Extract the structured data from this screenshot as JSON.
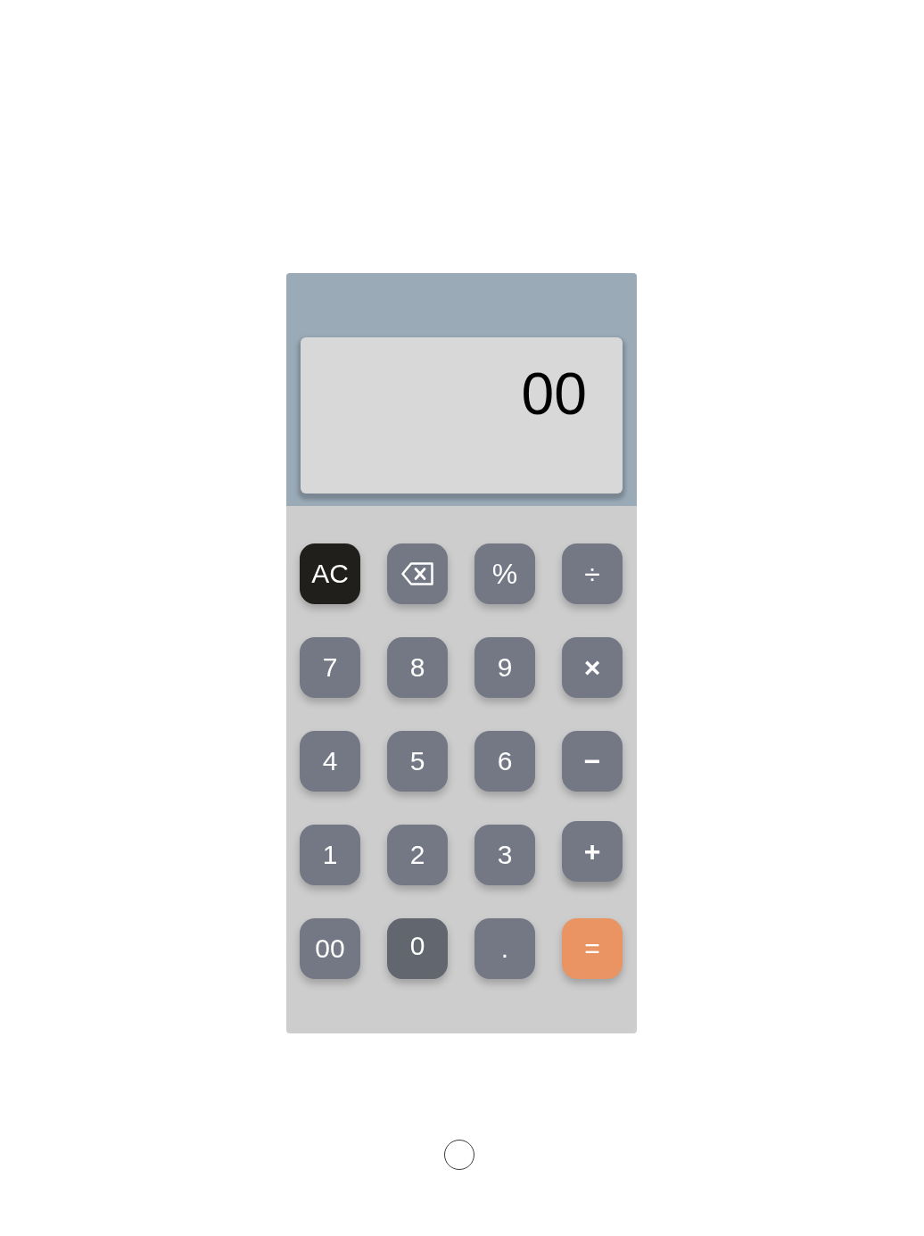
{
  "display": {
    "value": "00"
  },
  "keys": [
    {
      "label": "AC",
      "kind": "clear",
      "pressed": false,
      "hovered": false
    },
    {
      "kind": "backspace",
      "pressed": false,
      "hovered": false
    },
    {
      "label": "%",
      "kind": "function",
      "pressed": false,
      "hovered": false
    },
    {
      "label": "÷",
      "kind": "function",
      "pressed": false,
      "hovered": false
    },
    {
      "label": "7",
      "kind": "digit",
      "pressed": false,
      "hovered": false
    },
    {
      "label": "8",
      "kind": "digit",
      "pressed": false,
      "hovered": false
    },
    {
      "label": "9",
      "kind": "digit",
      "pressed": false,
      "hovered": false
    },
    {
      "label": "×",
      "kind": "operator",
      "pressed": false,
      "hovered": false
    },
    {
      "label": "4",
      "kind": "digit",
      "pressed": false,
      "hovered": false
    },
    {
      "label": "5",
      "kind": "digit",
      "pressed": false,
      "hovered": false
    },
    {
      "label": "6",
      "kind": "digit",
      "pressed": false,
      "hovered": false
    },
    {
      "label": "−",
      "kind": "operator",
      "pressed": false,
      "hovered": false
    },
    {
      "label": "1",
      "kind": "digit",
      "pressed": false,
      "hovered": false
    },
    {
      "label": "2",
      "kind": "digit",
      "pressed": false,
      "hovered": false
    },
    {
      "label": "3",
      "kind": "digit",
      "pressed": false,
      "hovered": false
    },
    {
      "label": "+",
      "kind": "operator",
      "pressed": false,
      "hovered": true
    },
    {
      "label": "00",
      "kind": "digit",
      "pressed": false,
      "hovered": false
    },
    {
      "label": "0",
      "kind": "digit",
      "pressed": true,
      "hovered": false
    },
    {
      "label": ".",
      "kind": "digit",
      "pressed": false,
      "hovered": false
    },
    {
      "label": "=",
      "kind": "equals",
      "pressed": false,
      "hovered": false
    }
  ]
}
